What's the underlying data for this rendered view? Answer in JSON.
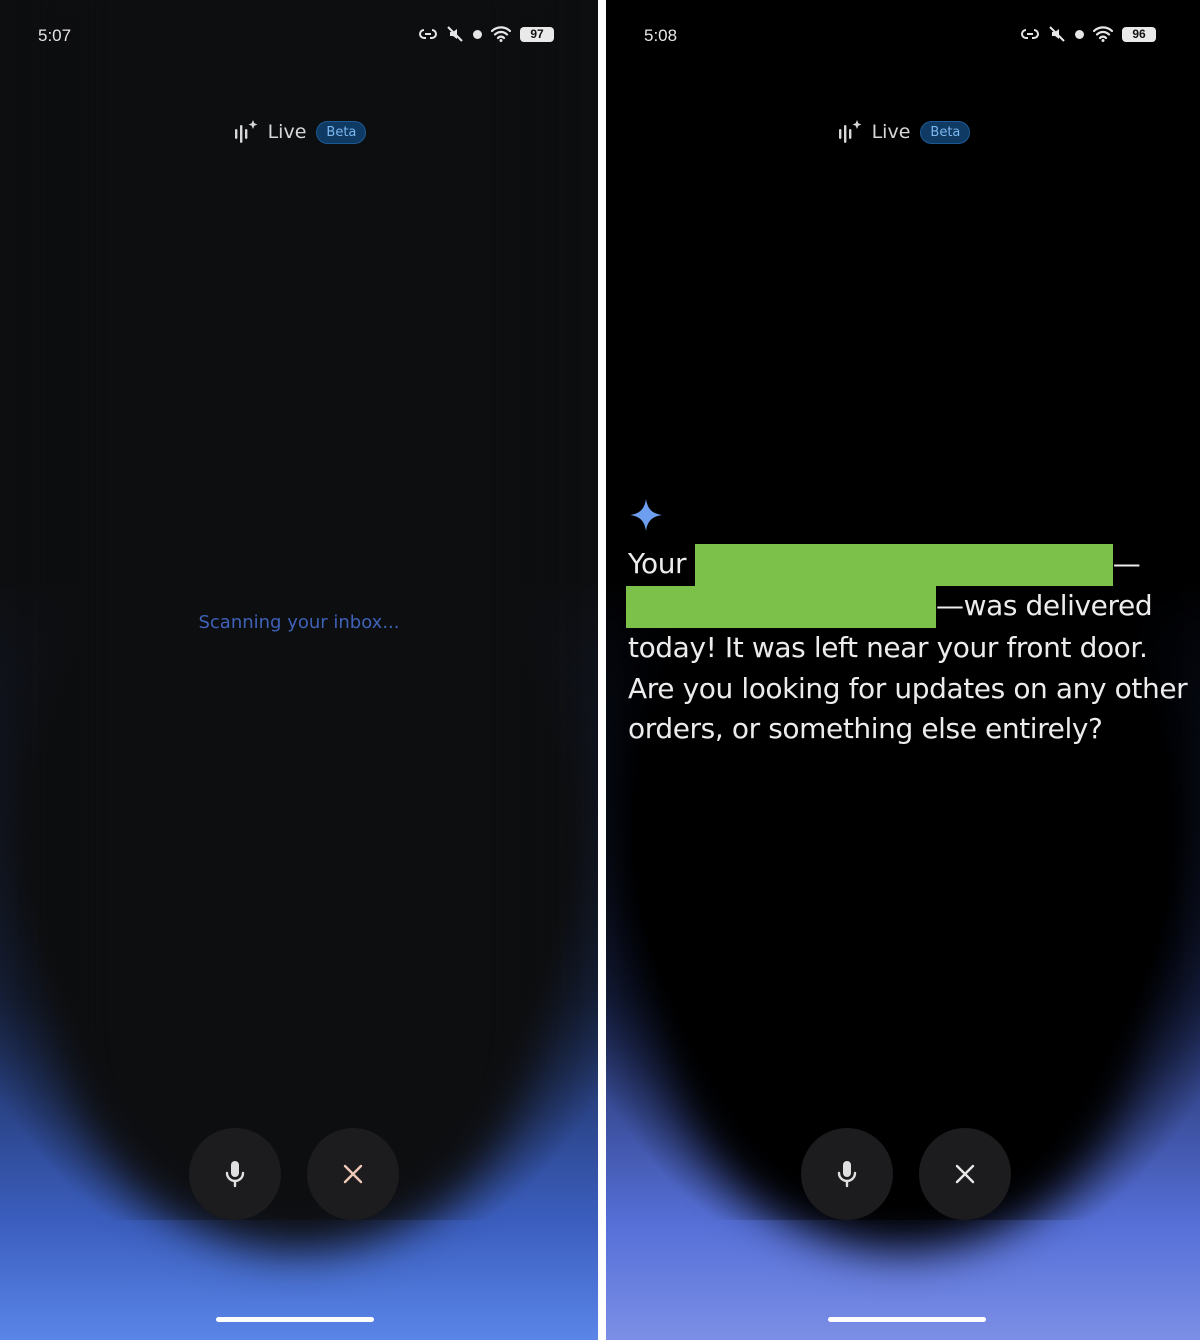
{
  "left": {
    "status": {
      "time": "5:07",
      "battery": "97",
      "icons": [
        "link-icon",
        "mute-icon",
        "dot-icon",
        "wifi-icon",
        "battery-icon"
      ]
    },
    "header": {
      "label": "Live",
      "badge": "Beta",
      "icon": "live-waveform-icon"
    },
    "status_message": "Scanning your inbox...",
    "controls": {
      "mic_icon": "mic-icon",
      "close_icon": "close-icon"
    }
  },
  "right": {
    "status": {
      "time": "5:08",
      "battery": "96",
      "icons": [
        "link-icon",
        "mute-icon",
        "dot-icon",
        "wifi-icon",
        "battery-icon"
      ]
    },
    "header": {
      "label": "Live",
      "badge": "Beta",
      "icon": "live-waveform-icon"
    },
    "response": {
      "part1": "Your",
      "dash1": "—",
      "part2": "—was delivered",
      "part3": "today! It was left near your front door. Are you looking for updates on any other orders, or something else entirely?"
    },
    "controls": {
      "mic_icon": "mic-icon",
      "close_icon": "close-icon"
    }
  },
  "colors": {
    "background": "#000000",
    "glow": "#5a86e8",
    "beta_bg": "#0e3a63",
    "beta_text": "#7cb7ef",
    "scanning_text": "#3f62b8",
    "redaction": "#7cc24a",
    "sparkle": "#6e9ef0"
  }
}
